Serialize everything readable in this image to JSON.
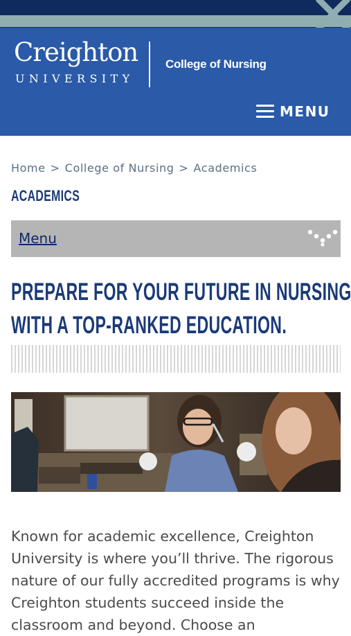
{
  "header": {
    "logo_word": "Creighton",
    "logo_sub": "UNIVERSITY",
    "college": "College of Nursing",
    "menu_label": "MENU"
  },
  "breadcrumb": {
    "items": [
      "Home",
      "College of Nursing",
      "Academics"
    ],
    "separator": ">"
  },
  "section_title": "ACADEMICS",
  "subnav": {
    "label": "Menu"
  },
  "headline": {
    "line1": "PREPARE FOR YOUR FUTURE IN NURSING",
    "line2": "WITH A TOP-RANKED EDUCATION."
  },
  "body": {
    "lines": [
      "Known for academic excellence, Creighton",
      "University is where you’ll thrive. The rigorous",
      "nature of our fully accredited programs is why",
      "Creighton students succeed inside the",
      "classroom and beyond. Choose an"
    ]
  },
  "colors": {
    "header_blue": "#2a5aa8",
    "top_navy": "#0f2a5c",
    "accent_teal": "#8faeb0",
    "title_navy": "#1a3a78",
    "subnav_gray": "#b5b5b5"
  },
  "icons": [
    "close-icon",
    "hamburger-icon",
    "dots-icon"
  ]
}
